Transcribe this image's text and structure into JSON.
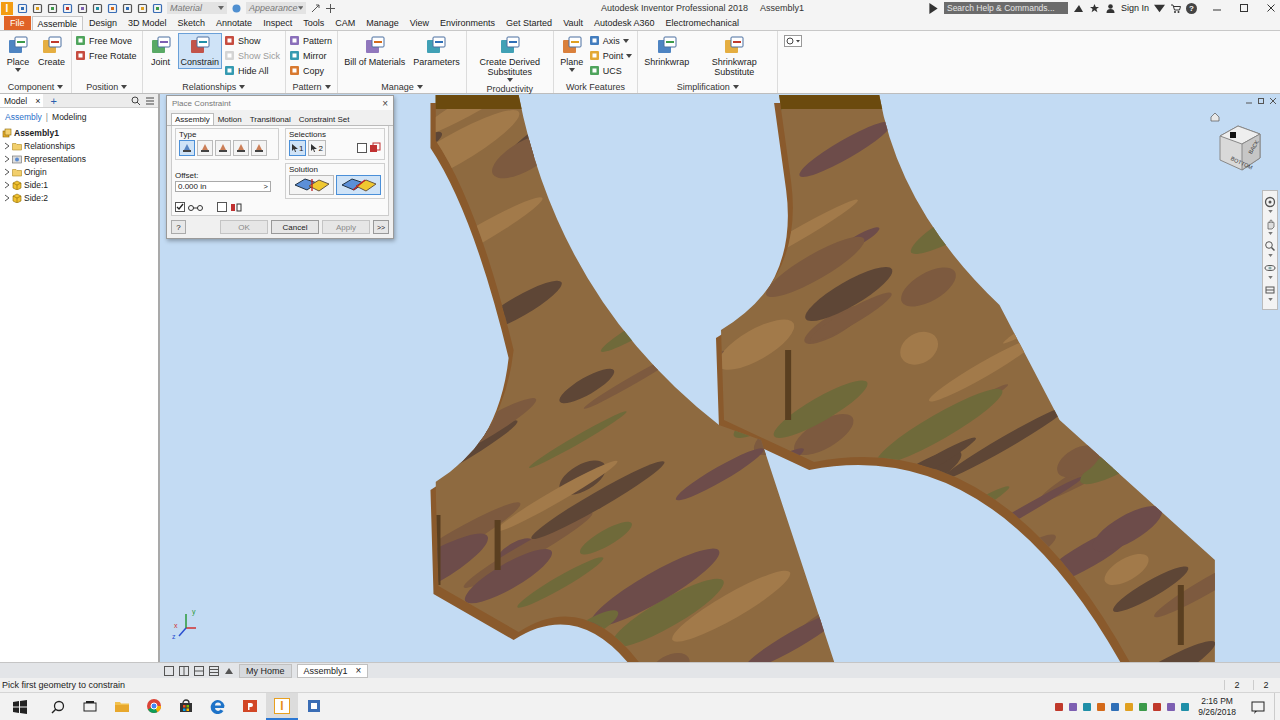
{
  "title_bar": {
    "logo": "I",
    "material": "Material",
    "appearance": "Appearance",
    "title": "Autodesk Inventor Professional 2018",
    "document": "Assembly1",
    "search_placeholder": "Search Help & Commands...",
    "sign_in": "Sign In",
    "help": "?"
  },
  "ribbon_tabs": [
    {
      "label": "File",
      "selected": false,
      "kind": "file"
    },
    {
      "label": "Assemble",
      "selected": true,
      "kind": "tab"
    },
    {
      "label": "Design",
      "selected": false,
      "kind": "tab"
    },
    {
      "label": "3D Model",
      "selected": false,
      "kind": "tab"
    },
    {
      "label": "Sketch",
      "selected": false,
      "kind": "tab"
    },
    {
      "label": "Annotate",
      "selected": false,
      "kind": "tab"
    },
    {
      "label": "Inspect",
      "selected": false,
      "kind": "tab"
    },
    {
      "label": "Tools",
      "selected": false,
      "kind": "tab"
    },
    {
      "label": "CAM",
      "selected": false,
      "kind": "tab"
    },
    {
      "label": "Manage",
      "selected": false,
      "kind": "tab"
    },
    {
      "label": "View",
      "selected": false,
      "kind": "tab"
    },
    {
      "label": "Environments",
      "selected": false,
      "kind": "tab"
    },
    {
      "label": "Get Started",
      "selected": false,
      "kind": "tab"
    },
    {
      "label": "Vault",
      "selected": false,
      "kind": "tab"
    },
    {
      "label": "Autodesk A360",
      "selected": false,
      "kind": "tab"
    },
    {
      "label": "Electromechanical",
      "selected": false,
      "kind": "tab"
    }
  ],
  "ribbon_groups": [
    {
      "label": "Component",
      "dropdown": true,
      "items": [
        {
          "kind": "large",
          "label": "Place",
          "selected": false,
          "dropdown": true
        },
        {
          "kind": "large",
          "label": "Create",
          "selected": false,
          "dropdown": false
        }
      ]
    },
    {
      "label": "Position",
      "dropdown": true,
      "items": [
        {
          "kind": "column",
          "tools": [
            {
              "label": "Free Move",
              "disabled": false,
              "dropdown": false
            },
            {
              "label": "Free Rotate",
              "disabled": false,
              "dropdown": false
            }
          ]
        }
      ]
    },
    {
      "label": "Relationships",
      "dropdown": true,
      "items": [
        {
          "kind": "large",
          "label": "Joint",
          "selected": false,
          "dropdown": false
        },
        {
          "kind": "large",
          "label": "Constrain",
          "selected": true,
          "dropdown": false
        },
        {
          "kind": "column",
          "tools": [
            {
              "label": "Show",
              "disabled": false,
              "dropdown": false
            },
            {
              "label": "Show Sick",
              "disabled": true,
              "dropdown": false
            },
            {
              "label": "Hide All",
              "disabled": false,
              "dropdown": false
            }
          ]
        }
      ]
    },
    {
      "label": "Pattern",
      "dropdown": true,
      "items": [
        {
          "kind": "column",
          "tools": [
            {
              "label": "Pattern",
              "disabled": false,
              "dropdown": false
            },
            {
              "label": "Mirror",
              "disabled": false,
              "dropdown": false
            },
            {
              "label": "Copy",
              "disabled": false,
              "dropdown": false
            }
          ]
        }
      ]
    },
    {
      "label": "Manage",
      "dropdown": true,
      "items": [
        {
          "kind": "large",
          "label": "Bill of Materials",
          "selected": false,
          "dropdown": false
        },
        {
          "kind": "large",
          "label": "Parameters",
          "selected": false,
          "dropdown": false
        }
      ]
    },
    {
      "label": "Productivity",
      "dropdown": false,
      "items": [
        {
          "kind": "large",
          "label": "Create Derived Substitutes",
          "selected": false,
          "dropdown": true
        }
      ]
    },
    {
      "label": "Work Features",
      "dropdown": false,
      "items": [
        {
          "kind": "large",
          "label": "Plane",
          "selected": false,
          "dropdown": true
        },
        {
          "kind": "column",
          "tools": [
            {
              "label": "Axis",
              "disabled": false,
              "dropdown": true
            },
            {
              "label": "Point",
              "disabled": false,
              "dropdown": true
            },
            {
              "label": "UCS",
              "disabled": false,
              "dropdown": false
            }
          ]
        }
      ]
    },
    {
      "label": "Simplification",
      "dropdown": true,
      "items": [
        {
          "kind": "large",
          "label": "Shrinkwrap",
          "selected": false,
          "dropdown": false
        },
        {
          "kind": "large",
          "label": "Shrinkwrap Substitute",
          "selected": false,
          "dropdown": false
        }
      ]
    }
  ],
  "browser": {
    "tab": "Model",
    "close": "×",
    "add": "+",
    "modes": [
      {
        "label": "Assembly",
        "selected": true
      },
      {
        "label": "Modeling",
        "selected": false
      }
    ],
    "separator": "|",
    "tree": {
      "label": "Assembly1",
      "children": [
        {
          "label": "Relationships",
          "kind": "folder",
          "expanded": false
        },
        {
          "label": "Representations",
          "kind": "representations",
          "expanded": false
        },
        {
          "label": "Origin",
          "kind": "folder",
          "expanded": false
        },
        {
          "label": "Side:1",
          "kind": "part",
          "expanded": false
        },
        {
          "label": "Side:2",
          "kind": "part",
          "expanded": false
        }
      ]
    }
  },
  "dialog": {
    "title": "Place Constraint",
    "close": "×",
    "tabs": [
      {
        "label": "Assembly",
        "selected": true
      },
      {
        "label": "Motion",
        "selected": false
      },
      {
        "label": "Transitional",
        "selected": false
      },
      {
        "label": "Constraint Set",
        "selected": false
      }
    ],
    "type_label": "Type",
    "types": [
      {
        "selected": true
      },
      {
        "selected": false
      },
      {
        "selected": false
      },
      {
        "selected": false
      },
      {
        "selected": false
      }
    ],
    "selections_label": "Selections",
    "selections": [
      {
        "label": "1",
        "selected": true
      },
      {
        "label": "2",
        "selected": false
      }
    ],
    "pick_part_first": false,
    "offset_label": "Offset:",
    "offset_value": "0.000 in",
    "offset_arrow": ">",
    "solution_label": "Solution",
    "solutions": [
      {
        "selected": false
      },
      {
        "selected": true
      }
    ],
    "options": [
      {
        "checked": true
      },
      {
        "checked": false
      }
    ],
    "help": "?",
    "buttons": [
      {
        "label": "OK",
        "disabled": true
      },
      {
        "label": "Cancel",
        "disabled": false
      },
      {
        "label": "Apply",
        "disabled": true
      }
    ],
    "more": ">>"
  },
  "view_cube": {
    "faces": [
      "BACK",
      "BOTTOM"
    ]
  },
  "triad": {
    "axes": [
      {
        "label": "x",
        "color": "#d03030"
      },
      {
        "label": "y",
        "color": "#2a9a3a"
      },
      {
        "label": "z",
        "color": "#2a4fd0"
      }
    ]
  },
  "document_tabs": [
    {
      "label": "My Home",
      "selected": false,
      "close": ""
    },
    {
      "label": "Assembly1",
      "selected": true,
      "close": "×"
    }
  ],
  "status_bar": {
    "message": "Pick first geometry to constrain",
    "counts": [
      "2",
      "2"
    ]
  },
  "taskbar": {
    "apps": [
      {
        "kind": "explorer",
        "active": false
      },
      {
        "kind": "chrome",
        "active": false
      },
      {
        "kind": "store",
        "active": false
      },
      {
        "kind": "edge",
        "active": false
      },
      {
        "kind": "powerpoint",
        "active": false
      },
      {
        "kind": "inventor",
        "active": true
      },
      {
        "kind": "other",
        "active": false
      }
    ],
    "time": "2:16 PM",
    "date": "9/26/2018"
  }
}
